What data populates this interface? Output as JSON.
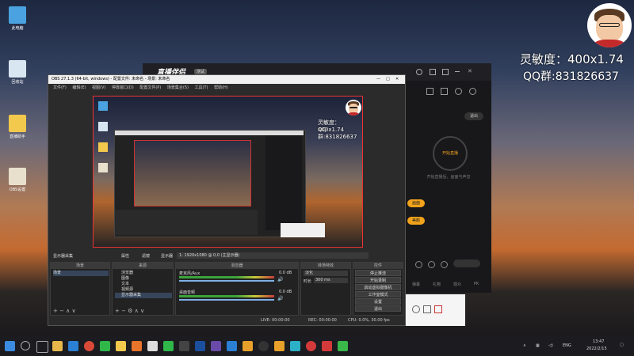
{
  "desktop": {
    "icons": [
      {
        "label": "此电脑",
        "color": "#4aa3e0"
      },
      {
        "label": "回收站",
        "color": "#d8e6f2"
      },
      {
        "label": "直播助手",
        "color": "#f2c94c"
      },
      {
        "label": "OBS设置",
        "color": "#e8e0cc"
      }
    ]
  },
  "overlay": {
    "sensitivity": "灵敏度：400x1.74",
    "qq_group": "QQ群:831826637"
  },
  "live_app": {
    "logo": "直播伴侣",
    "badge": "测试",
    "exit_button": "退出",
    "start_button": "开始直播",
    "start_hint": "开始直播后，画面与声音",
    "btn_a": "画面",
    "btn_b": "美颜",
    "bottom_link_1": "弹幕",
    "bottom_link_2": "礼物",
    "bottom_link_3": "观众",
    "bottom_link_4": "PK"
  },
  "obs": {
    "title": "OBS 27.1.3 (64-bit, windows) - 配置文件: 未命名 - 场景: 未命名",
    "menu": [
      "文件(F)",
      "编辑(E)",
      "视图(V)",
      "停靠窗口(D)",
      "配置文件(P)",
      "场景集合(S)",
      "工具(T)",
      "帮助(H)"
    ],
    "scene_bar": {
      "source": "显示器采集",
      "properties": "属性",
      "filters": "滤镜",
      "display_label": "显示器",
      "display_value": "1: 1920x1080 @ 0,0 (主显示器)"
    },
    "docks": {
      "scenes": "场景",
      "sources": "来源",
      "mixer": "混音器",
      "transitions": "转场特效",
      "controls": "控件"
    },
    "scene_items": [
      "场景"
    ],
    "source_items": [
      "浏览器",
      "图像",
      "文本",
      "视频源",
      "显示器采集"
    ],
    "mixer_items": [
      {
        "name": "麦克风/Aux",
        "db": "0.0 dB"
      },
      {
        "name": "桌面音频",
        "db": "0.0 dB"
      }
    ],
    "transition": {
      "type": "淡化",
      "duration_label": "时长",
      "duration": "300 ms"
    },
    "controls": [
      "停止推流",
      "开始录制",
      "启动虚拟摄像机",
      "工作室模式",
      "设置",
      "退出"
    ],
    "status": {
      "live": "LIVE: 00:00:00",
      "rec": "REC: 00:00:00",
      "cpu": "CPU: 0.0%, 30.00 fps"
    }
  },
  "taskbar": {
    "lang": "ENG",
    "time": "13:47",
    "date": "2022/2/15",
    "icons": [
      "start",
      "search",
      "task-view",
      "explorer",
      "edge",
      "chrome",
      "wechat",
      "qq",
      "steam",
      "obs",
      "netease-music",
      "video",
      "store",
      "photos"
    ]
  },
  "colors": {
    "accent_orange": "#f2a31b",
    "obs_red_frame": "#ee3333",
    "live_bg": "#1e1e22"
  }
}
